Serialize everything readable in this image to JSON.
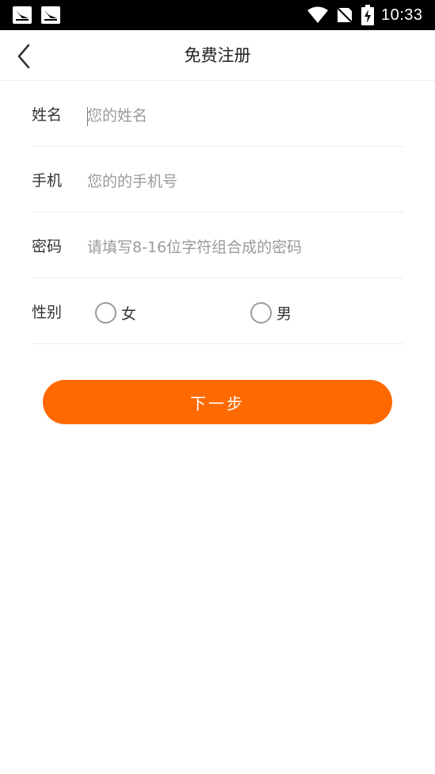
{
  "status_bar": {
    "time": "10:33",
    "icons": [
      "notification-icon",
      "notification-icon",
      "wifi-icon",
      "no-sim-signal-icon",
      "battery-charging-icon"
    ]
  },
  "nav": {
    "title": "免费注册",
    "back_icon": "chevron-left-icon"
  },
  "form": {
    "name": {
      "label": "姓名",
      "placeholder": "您的姓名",
      "value": ""
    },
    "phone": {
      "label": "手机",
      "placeholder": "您的的手机号",
      "value": ""
    },
    "password": {
      "label": "密码",
      "placeholder": "请填写8-16位字符组合成的密码",
      "value": ""
    },
    "gender": {
      "label": "性别",
      "options": [
        {
          "label": "女",
          "selected": false
        },
        {
          "label": "男",
          "selected": false
        }
      ]
    }
  },
  "next_button": {
    "label": "下一步"
  },
  "colors": {
    "accent": "#ff6a00",
    "status_bar": "#000000",
    "divider": "#ececec",
    "placeholder": "#9a9a9a"
  }
}
